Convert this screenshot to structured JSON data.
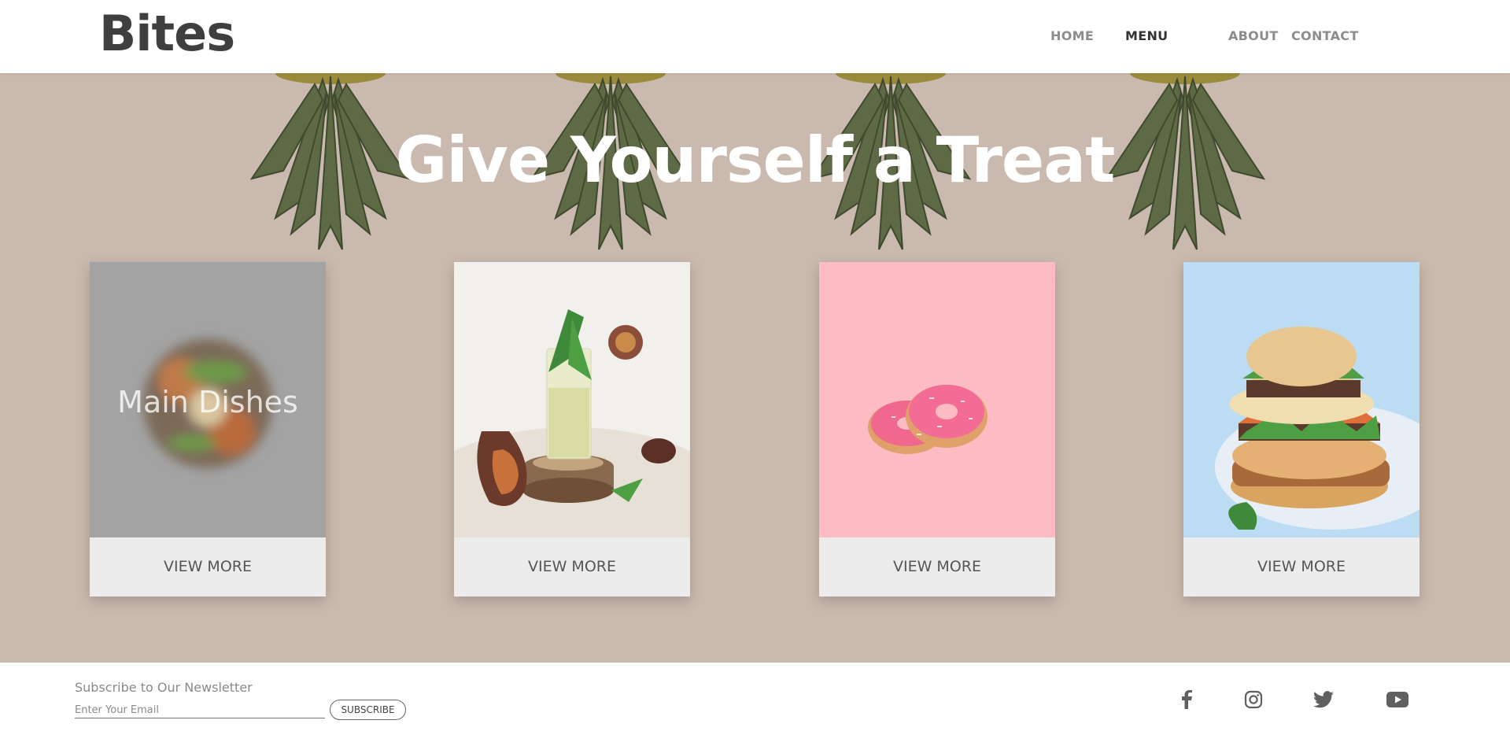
{
  "header": {
    "logo": "Bites",
    "nav": [
      {
        "label": "HOME",
        "active": false
      },
      {
        "label": "MENU",
        "active": true
      },
      {
        "label": "ABOUT",
        "active": false
      },
      {
        "label": "CONTACT",
        "active": false
      }
    ]
  },
  "hero": {
    "title": "Give Yourself a Treat",
    "background_color": "#c9b9ae"
  },
  "cards": [
    {
      "overlay_title": "Main Dishes",
      "image": "blurred-salad-bowl",
      "button": "VIEW MORE"
    },
    {
      "overlay_title": "",
      "image": "fig-mint-drink",
      "button": "VIEW MORE"
    },
    {
      "overlay_title": "",
      "image": "pink-donuts",
      "button": "VIEW MORE"
    },
    {
      "overlay_title": "",
      "image": "sandwich-stack",
      "button": "VIEW MORE"
    }
  ],
  "footer": {
    "newsletter_label": "Subscribe to Our Newsletter",
    "email_placeholder": "Enter Your Email",
    "subscribe_label": "SUBSCRIBE",
    "social": [
      "facebook-icon",
      "instagram-icon",
      "twitter-icon",
      "youtube-icon"
    ]
  },
  "colors": {
    "text_dark": "#3f3f3f",
    "nav_muted": "#8c8c8c",
    "card_button_bg": "#ececec",
    "donut_bg": "#fdbcc4",
    "sandwich_bg": "#bcdcf3"
  }
}
